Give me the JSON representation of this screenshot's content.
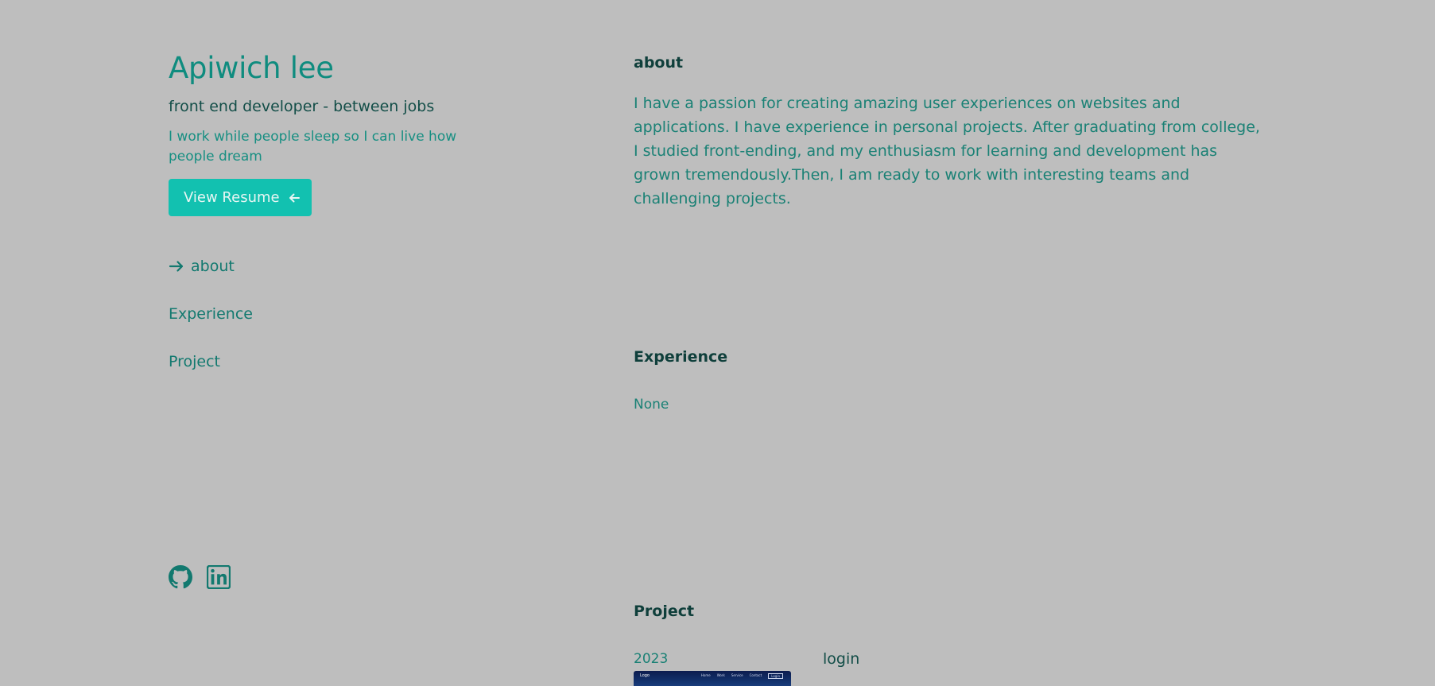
{
  "profile": {
    "name": "Apiwich lee",
    "role": "front end developer - between jobs",
    "tagline": "I work while people sleep so I can live how people dream",
    "resume_button": "View Resume"
  },
  "nav": {
    "items": [
      {
        "label": "about",
        "active": true
      },
      {
        "label": "Experience",
        "active": false
      },
      {
        "label": "Project",
        "active": false
      }
    ]
  },
  "socials": [
    {
      "icon": "github-icon"
    },
    {
      "icon": "linkedin-icon"
    }
  ],
  "about": {
    "title": "about",
    "text": "I have a passion for creating amazing user experiences on websites and applications. I have experience in personal projects. After graduating from college, I studied front-ending, and my enthusiasm for learning and development has grown tremendously.Then, I am ready to work with interesting teams and challenging projects."
  },
  "experience": {
    "title": "Experience",
    "value": "None"
  },
  "project": {
    "title": "Project",
    "items": [
      {
        "year": "2023",
        "name": "login",
        "thumb_logo": "Logo",
        "thumb_nav": [
          "Home",
          "Work",
          "Service",
          "Contact"
        ],
        "thumb_login": "Login"
      }
    ]
  },
  "colors": {
    "background": "#bebebe",
    "accent": "#12c1b0",
    "heading": "#0f8c7f",
    "text": "#1a8175",
    "dark": "#0f3f3b"
  }
}
